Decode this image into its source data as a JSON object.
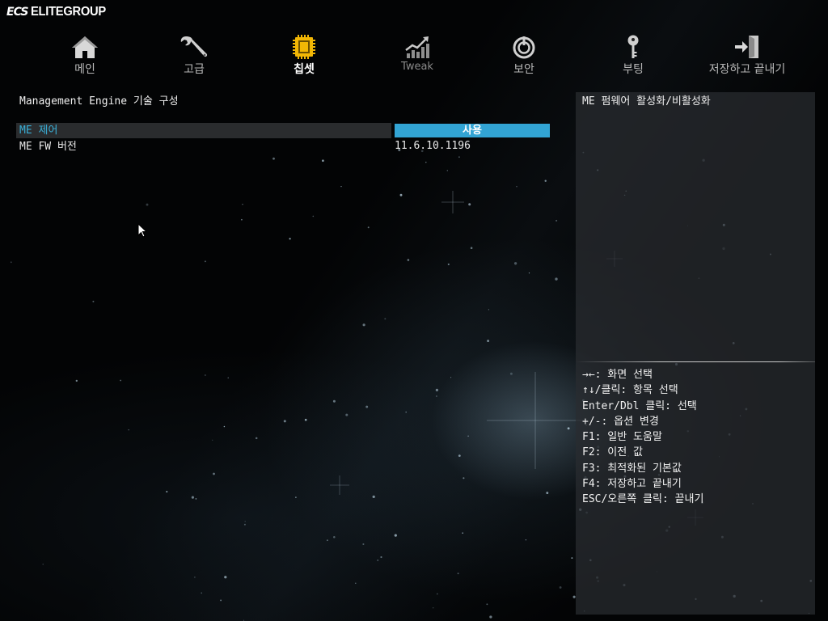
{
  "brand": {
    "mark": "ECS",
    "name": "ELITEGROUP"
  },
  "nav": {
    "items": [
      {
        "label": "메인",
        "icon": "home-icon"
      },
      {
        "label": "고급",
        "icon": "wrench-icon"
      },
      {
        "label": "칩셋",
        "icon": "chip-icon",
        "active": true
      },
      {
        "label": "Tweak",
        "icon": "chart-icon"
      },
      {
        "label": "보안",
        "icon": "power-lock-icon"
      },
      {
        "label": "부팅",
        "icon": "key-icon"
      },
      {
        "label": "저장하고 끝내기",
        "icon": "exit-icon"
      }
    ]
  },
  "main": {
    "title": "Management Engine 기술 구성",
    "rows": [
      {
        "label": "ME 제어",
        "value": "사용",
        "selected": true
      },
      {
        "label": "ME FW 버전",
        "value": "11.6.10.1196"
      }
    ]
  },
  "help": {
    "description": "ME 펌웨어 활성화/비활성화",
    "keys": [
      "→←: 화면 선택",
      "↑↓/클릭: 항목 선택",
      "Enter/Dbl 클릭: 선택",
      "+/-: 옵션 변경",
      "F1: 일반 도움말",
      "F2: 이전 값",
      "F3: 최적화된 기본값",
      "F4: 저장하고 끝내기",
      "ESC/오른쪽 클릭: 끝내기"
    ]
  },
  "colors": {
    "accent": "#32a4d4",
    "selected_text": "#3ab0d8",
    "active_icon": "#f2b705"
  }
}
